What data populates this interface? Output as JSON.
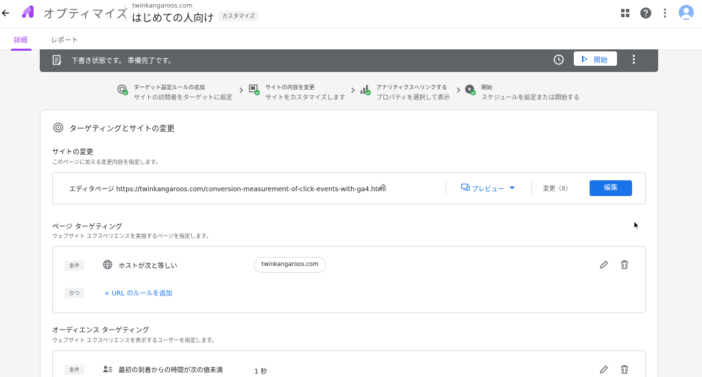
{
  "header": {
    "app_name": "オプティマイズ",
    "domain": "twinkangaroos.com",
    "experience_title": "はじめての人向け",
    "experience_type": "カスタマイズ",
    "icons": [
      "back-arrow-icon",
      "optimize-logo-icon",
      "apps-grid-icon",
      "help-icon",
      "more-vert-icon",
      "account-avatar"
    ]
  },
  "tabs": [
    {
      "label": "詳細",
      "active": true
    },
    {
      "label": "レポート",
      "active": false
    }
  ],
  "status_bar": {
    "text": "下書き状態です。 準備完了です。",
    "start_label": "開始"
  },
  "steps": [
    {
      "title": "ターゲット設定ルールの追加",
      "desc": "サイトの訪問者をターゲットに設定"
    },
    {
      "title": "サイトの内容を変更",
      "desc": "サイトをカスタマイズします"
    },
    {
      "title": "アナリティクスへリンクする",
      "desc": "プロパティを選択して表示"
    },
    {
      "title": "開始",
      "desc": "スケジュールを設定または開始する"
    }
  ],
  "card": {
    "title": "ターゲティングとサイトの変更",
    "site_changes": {
      "title": "サイトの変更",
      "desc": "このページに加える変更内容を指定します。",
      "editor_label": "エディタページ https://twinkangaroos.com/conversion-measurement-of-click-events-with-ga4.html",
      "preview_label": "プレビュー",
      "changes_label": "変更（8）",
      "edit_label": "編集"
    },
    "page_targeting": {
      "title": "ページ ターゲティング",
      "desc": "ウェブサイト エクスペリエンスを実施するページを指定します。",
      "condition_chip": "条件",
      "condition_text": "ホストが次と等しい",
      "condition_value": "twinkangaroos.com",
      "and_chip": "かつ",
      "add_rule_label": "+ URL のルールを追加"
    },
    "audience_targeting": {
      "title": "オーディエンス ターゲティング",
      "desc": "ウェブサイト エクスペリエンスを表示するユーザーを指定します。",
      "condition_chip": "条件",
      "condition_text": "最初の到着からの時間が次の値未満",
      "condition_value": "1 秒"
    }
  },
  "colors": {
    "accent_purple": "#a142f4",
    "primary_blue": "#1a73e8",
    "status_bar_bg": "#5f6368",
    "check_green": "#34a853"
  }
}
